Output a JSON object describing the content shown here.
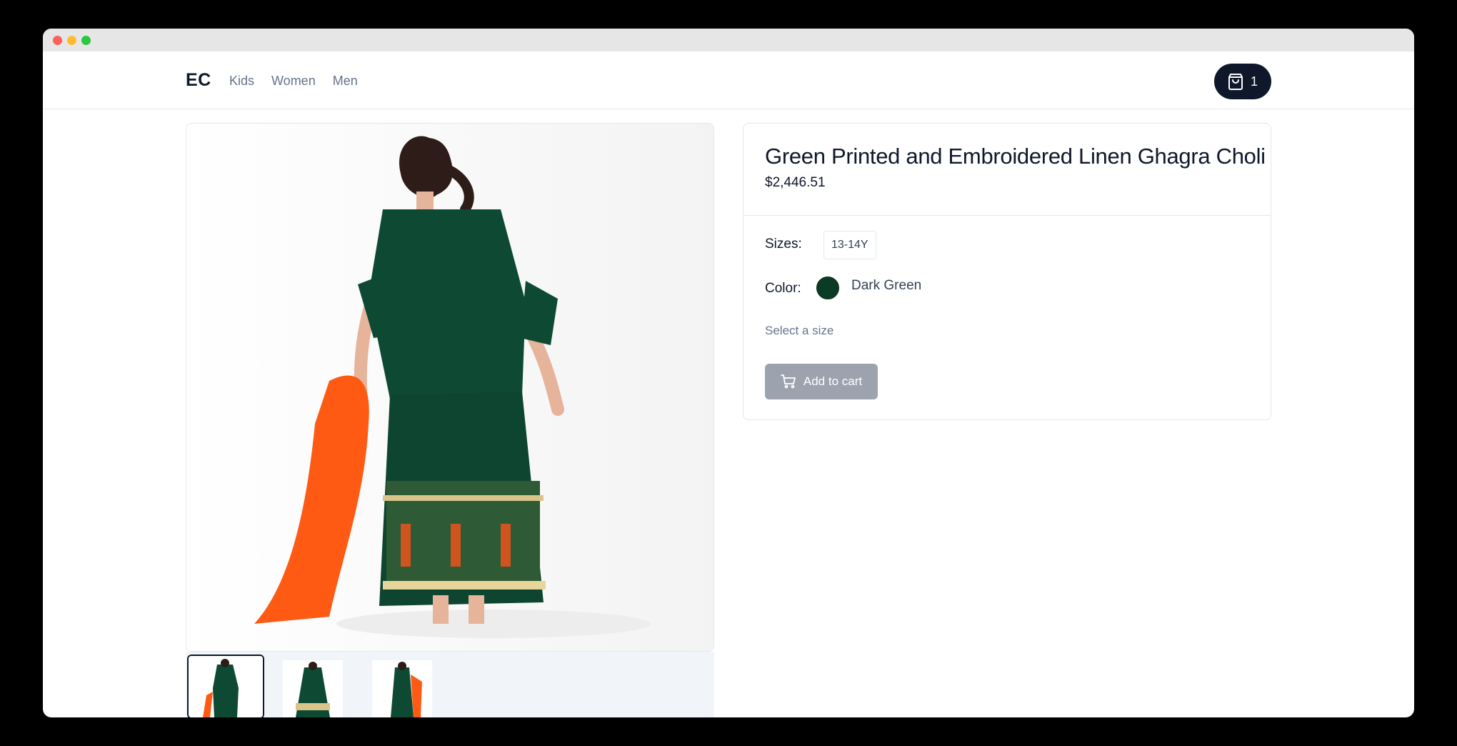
{
  "window": {
    "controls": [
      "close",
      "minimize",
      "zoom"
    ]
  },
  "navbar": {
    "logo": "EC",
    "links": [
      "Kids",
      "Women",
      "Men"
    ],
    "cart_count": "1",
    "cart_icon": "shopping-bag-icon"
  },
  "product": {
    "title": "Green Printed and Embroidered Linen Ghagra Choli",
    "price": "$2,446.51",
    "sizes_label": "Sizes:",
    "sizes": [
      "13-14Y"
    ],
    "color_label": "Color:",
    "color_name": "Dark Green",
    "color_hex": "#0b3b25",
    "hint": "Select a size",
    "add_to_cart": "Add to cart",
    "add_to_cart_icon": "cart-icon"
  },
  "gallery": {
    "thumbnails": 3,
    "selected_index": 0
  },
  "colors": {
    "dark": "#0f172a",
    "muted_text": "#64748b",
    "disabled_button": "#9ca3af",
    "thumb_strip_bg": "#f1f5f9"
  }
}
